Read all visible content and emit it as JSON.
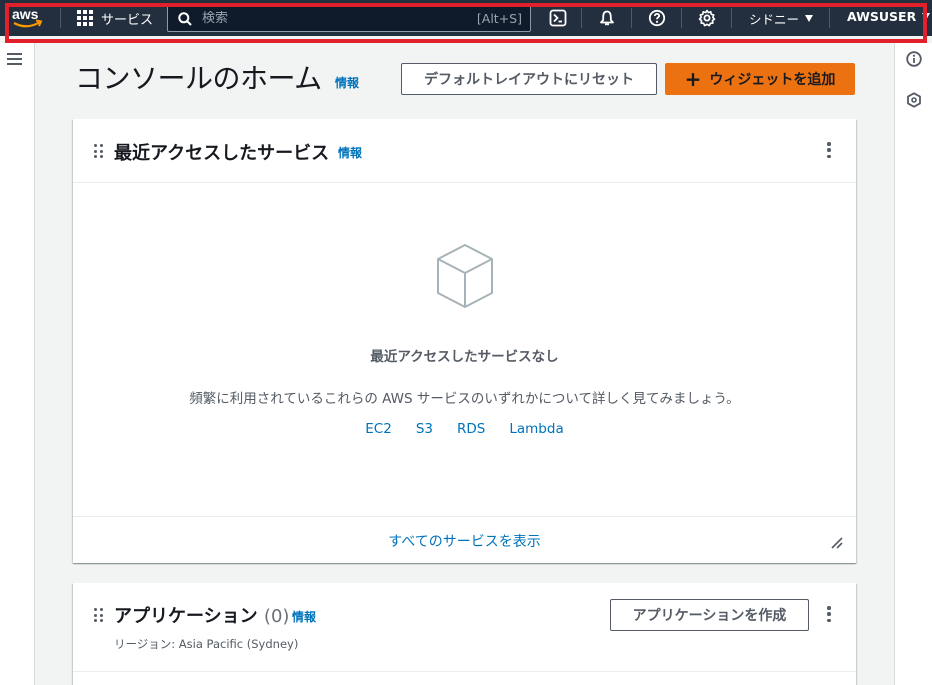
{
  "nav": {
    "services_label": "サービス",
    "search_placeholder": "検索",
    "search_shortcut": "[Alt+S]",
    "region_label": "シドニー",
    "user_label": "AWSUSER",
    "icons": [
      "cloudshell-icon",
      "bell-icon",
      "help-icon",
      "settings-icon"
    ]
  },
  "header": {
    "title": "コンソールのホーム",
    "info": "情報",
    "reset_button": "デフォルトレイアウトにリセット",
    "add_widget_button": "ウィジェットを追加"
  },
  "recent": {
    "title": "最近アクセスしたサービス",
    "info": "情報",
    "empty_title": "最近アクセスしたサービスなし",
    "empty_desc": "頻繁に利用されているこれらの AWS サービスのいずれかについて詳しく見てみましょう。",
    "services": [
      "EC2",
      "S3",
      "RDS",
      "Lambda"
    ],
    "view_all": "すべてのサービスを表示"
  },
  "apps": {
    "title": "アプリケーション",
    "count": "(0)",
    "info": "情報",
    "region": "リージョン: Asia Pacific (Sydney)",
    "create_button": "アプリケーションを作成"
  },
  "colors": {
    "nav_bg": "#232f3e",
    "accent": "#ec7211",
    "link": "#0073bb",
    "highlight": "#e0202b"
  }
}
